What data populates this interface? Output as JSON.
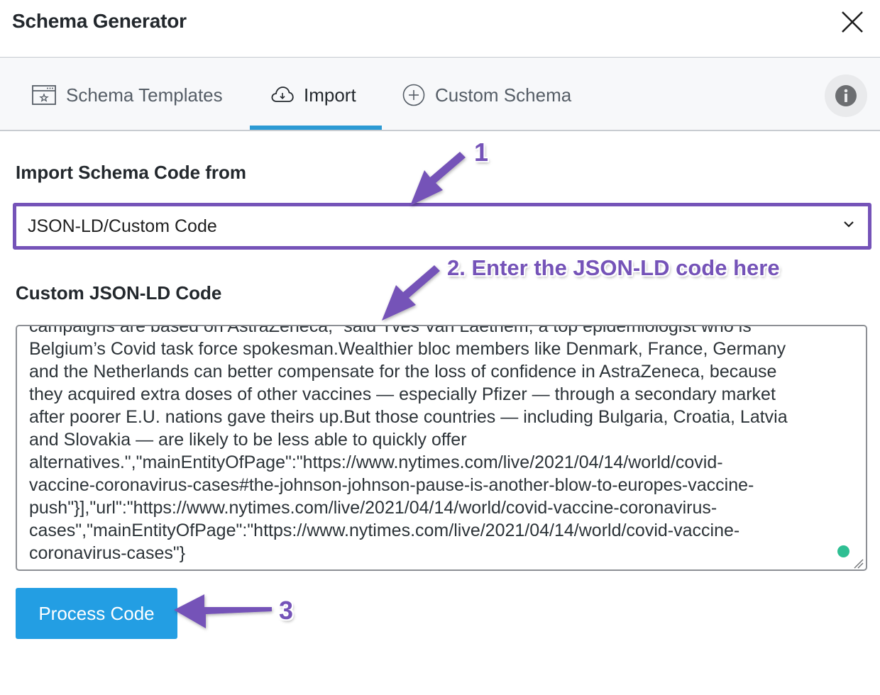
{
  "dialog": {
    "title": "Schema Generator",
    "close_icon": "close-icon"
  },
  "tabs": [
    {
      "label": "Schema Templates",
      "icon": "browser-star-icon",
      "active": false
    },
    {
      "label": "Import",
      "icon": "cloud-download-icon",
      "active": true
    },
    {
      "label": "Custom Schema",
      "icon": "plus-circle-icon",
      "active": false
    }
  ],
  "info_icon": "info-icon",
  "import": {
    "source_label": "Import Schema Code from",
    "source_selected": "JSON-LD/Custom Code",
    "code_label": "Custom JSON-LD Code",
    "code_value": "campaigns are based on AstraZeneca,” said Yves Van Laethem, a top epidemiologist who is\nBelgium’s Covid task force spokesman.Wealthier bloc members like Denmark, France, Germany\nand the Netherlands can better compensate for the loss of confidence in AstraZeneca, because\nthey acquired extra doses of other vaccines — especially Pfizer — through a secondary market\nafter poorer E.U. nations gave theirs up.But those countries — including Bulgaria, Croatia, Latvia\nand Slovakia — are likely to be less able to quickly offer\nalternatives.\",\"mainEntityOfPage\":\"https://www.nytimes.com/live/2021/04/14/world/covid-\nvaccine-coronavirus-cases#the-johnson-johnson-pause-is-another-blow-to-europes-vaccine-\npush\"}],\"url\":\"https://www.nytimes.com/live/2021/04/14/world/covid-vaccine-coronavirus-\ncases\",\"mainEntityOfPage\":\"https://www.nytimes.com/live/2021/04/14/world/covid-vaccine-\ncoronavirus-cases\"}",
    "process_button": "Process Code"
  },
  "annotations": {
    "step1": "1",
    "step2": "2. Enter the JSON-LD code here",
    "step3": "3"
  },
  "colors": {
    "annotation": "#7553b8",
    "accent_tab": "#2c9ad4",
    "button": "#239ee3",
    "grammarly": "#2fbf93"
  }
}
